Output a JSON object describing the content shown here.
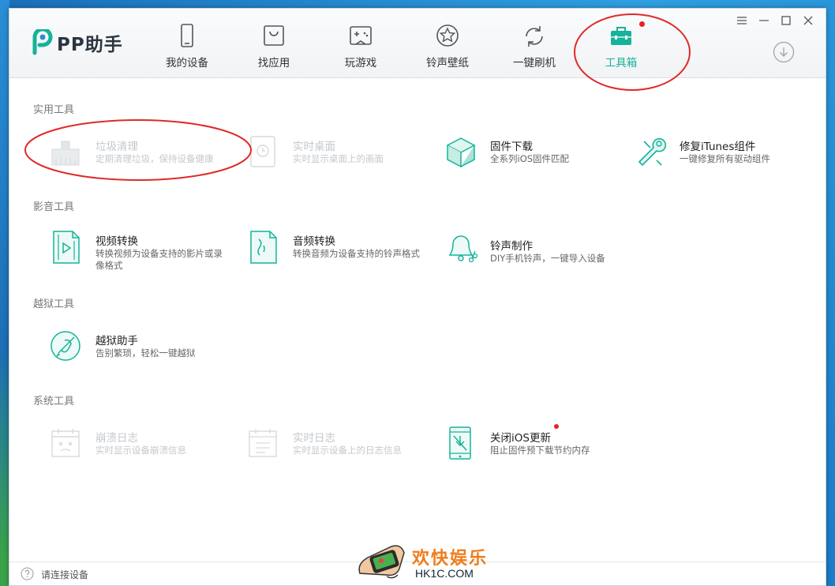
{
  "app": {
    "name": "PP助手"
  },
  "nav": [
    {
      "label": "我的设备",
      "icon": "phone-icon"
    },
    {
      "label": "找应用",
      "icon": "shopping-bag-icon"
    },
    {
      "label": "玩游戏",
      "icon": "gamepad-icon"
    },
    {
      "label": "铃声壁纸",
      "icon": "star-icon"
    },
    {
      "label": "一键刷机",
      "icon": "refresh-icon"
    },
    {
      "label": "工具箱",
      "icon": "toolbox-icon",
      "active": true,
      "badge": true
    }
  ],
  "window_controls": [
    "menu-icon",
    "minimize-icon",
    "maximize-icon",
    "close-icon"
  ],
  "sections": {
    "practical": {
      "title": "实用工具",
      "tools": [
        {
          "name": "垃圾清理",
          "desc": "定期清理垃圾，保持设备健康",
          "disabled": true,
          "icon": "broom-icon"
        },
        {
          "name": "实时桌面",
          "desc": "实时显示桌面上的画面",
          "disabled": true,
          "icon": "screen-mirror-icon"
        },
        {
          "name": "固件下载",
          "desc": "全系列iOS固件匹配",
          "disabled": false,
          "icon": "cube-icon"
        },
        {
          "name": "修复iTunes组件",
          "desc": "一键修复所有驱动组件",
          "disabled": false,
          "icon": "wrench-icon"
        }
      ]
    },
    "media": {
      "title": "影音工具",
      "tools": [
        {
          "name": "视频转换",
          "desc": "转换视频为设备支持的影片或录像格式",
          "disabled": false,
          "icon": "video-file-icon"
        },
        {
          "name": "音频转换",
          "desc": "转换音频为设备支持的铃声格式",
          "disabled": false,
          "icon": "audio-file-icon"
        },
        {
          "name": "铃声制作",
          "desc": "DIY手机铃声，一键导入设备",
          "disabled": false,
          "icon": "bell-scissors-icon"
        }
      ]
    },
    "jailbreak": {
      "title": "越狱工具",
      "tools": [
        {
          "name": "越狱助手",
          "desc": "告别繁琐，轻松一键越狱",
          "disabled": false,
          "icon": "jailbreak-icon"
        }
      ]
    },
    "system": {
      "title": "系统工具",
      "tools": [
        {
          "name": "崩溃日志",
          "desc": "实时显示设备崩溃信息",
          "disabled": true,
          "icon": "crash-log-icon"
        },
        {
          "name": "实时日志",
          "desc": "实时显示设备上的日志信息",
          "disabled": true,
          "icon": "log-icon"
        },
        {
          "name": "关闭iOS更新",
          "desc": "阻止固件预下载节约内存",
          "disabled": false,
          "badge": true,
          "icon": "block-update-icon"
        }
      ]
    }
  },
  "footer": {
    "status": "请连接设备"
  },
  "watermark": {
    "cn": "欢快娱乐",
    "en": "HK1C.COM"
  },
  "colors": {
    "accent": "#14b39a",
    "badge": "#e8202a",
    "annotation": "#e02a2a"
  }
}
